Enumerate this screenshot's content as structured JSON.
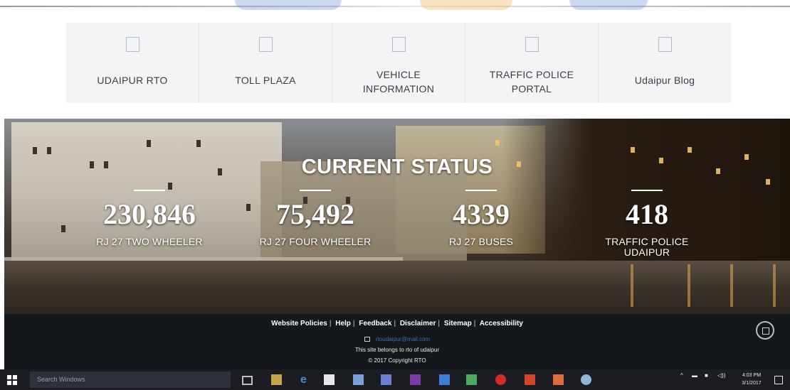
{
  "quick_links": [
    {
      "label": "UDAIPUR RTO"
    },
    {
      "label": "TOLL PLAZA"
    },
    {
      "label": "VEHICLE\nINFORMATION"
    },
    {
      "label": "TRAFFIC POLICE\nPORTAL"
    },
    {
      "label": "Udaipur Blog"
    }
  ],
  "status": {
    "title": "CURRENT STATUS",
    "stats": [
      {
        "value": "230,846",
        "label": "RJ 27 TWO WHEELER"
      },
      {
        "value": "75,492",
        "label": "RJ 27 FOUR WHEELER"
      },
      {
        "value": "4339",
        "label": "RJ 27 BUSES"
      },
      {
        "value": "418",
        "label": "TRAFFIC POLICE\nUDAIPUR"
      }
    ]
  },
  "footer": {
    "links": [
      "Website Policies",
      "Help",
      "Feedback",
      "Disclaimer",
      "Sitemap",
      "Accessibility"
    ],
    "email": "rtoudaipur@mail.com",
    "ownership": "This site belongs to rto of udaipur",
    "copyright": "© 2017 Copyright RTO"
  },
  "taskbar": {
    "search_placeholder": "Search Windows",
    "time": "4:03 PM",
    "date": "3/1/2017",
    "icons": [
      "task-view-icon",
      "file-explorer-icon",
      "edge-icon",
      "store-icon",
      "photos-icon",
      "media-icon",
      "onenote-icon",
      "mail-icon",
      "calculator-icon",
      "opera-icon",
      "powerpoint-icon",
      "app-icon",
      "paint-icon"
    ]
  },
  "colors": {
    "link_bg": "#f3f4f5",
    "footer_bg": "#14181c",
    "taskbar_bg": "#1c1d22",
    "email_link": "#3a6fb5"
  }
}
